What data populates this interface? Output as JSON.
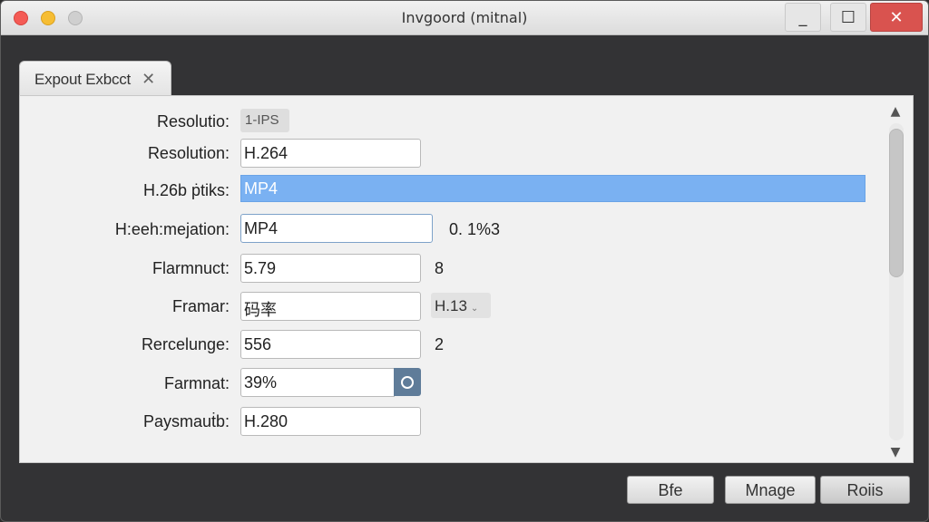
{
  "window": {
    "title": "Invgoord (mitnal)",
    "controls": {
      "minimize": "_",
      "maximize": "☐",
      "close": "✕"
    },
    "colors": {
      "close": "#d9534f",
      "accent": "#7ab1f2"
    }
  },
  "tab": {
    "label": "Expout Exbcct",
    "close": "✕"
  },
  "form": {
    "chip": "1-IPS",
    "rows": [
      {
        "label": "Resolutio:"
      },
      {
        "label": "Resolution:",
        "value": "H.264"
      },
      {
        "label": "H.26b ṗtiks:",
        "value": "MP4"
      },
      {
        "label": "H:eeh:mejation:",
        "value": "MP4",
        "extra": "0. 1%3"
      },
      {
        "label": "Flarmnuct:",
        "value": "5.79",
        "extra": "8"
      },
      {
        "label": "Framar:",
        "value": "码率",
        "dropdown": "H.13"
      },
      {
        "label": "Rercelunge:",
        "value": "556",
        "extra": "2"
      },
      {
        "label": "Farmnat:",
        "value": "39%"
      },
      {
        "label": "Paysmauṫb:",
        "value": "H.280"
      }
    ]
  },
  "scrollbar": {
    "up": "▲",
    "down": "▼"
  },
  "footer": {
    "btn1": "Bfe",
    "btn2": "Mnage",
    "btn3": "Roiis"
  }
}
